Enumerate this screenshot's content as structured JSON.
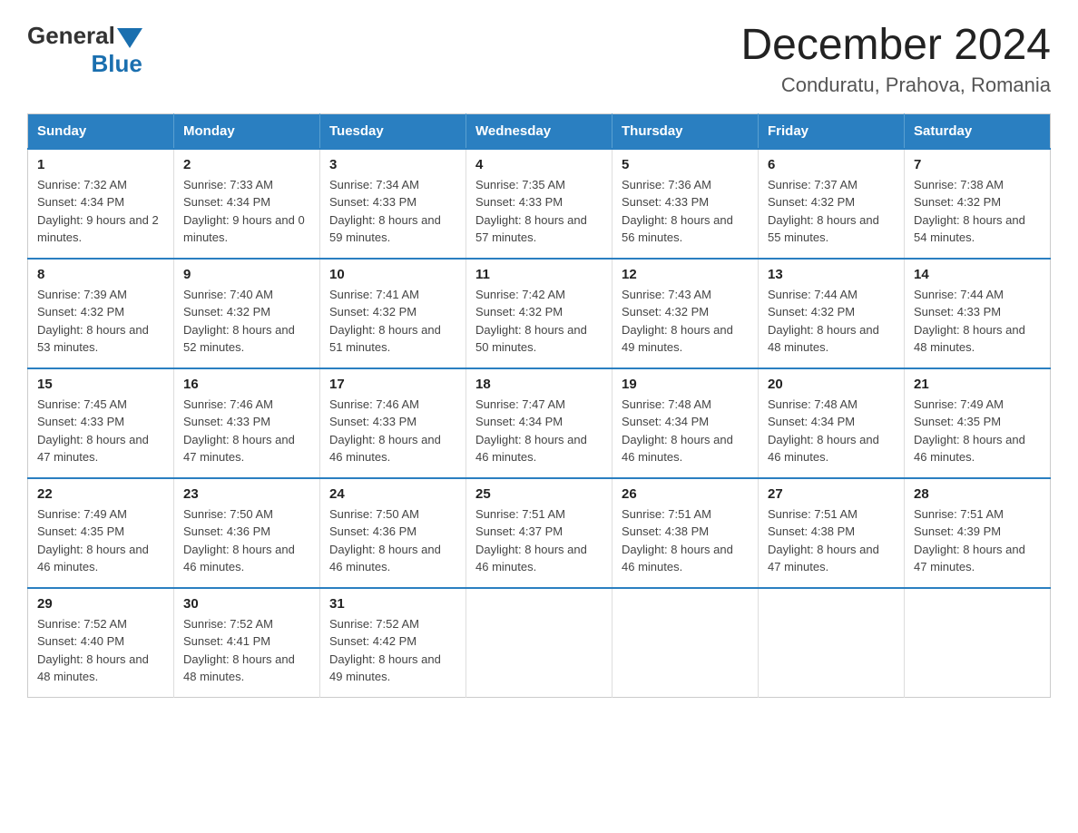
{
  "header": {
    "logo": {
      "general": "General",
      "blue": "Blue"
    },
    "title": "December 2024",
    "subtitle": "Conduratu, Prahova, Romania"
  },
  "calendar": {
    "weekdays": [
      "Sunday",
      "Monday",
      "Tuesday",
      "Wednesday",
      "Thursday",
      "Friday",
      "Saturday"
    ],
    "weeks": [
      [
        {
          "day": "1",
          "sunrise": "7:32 AM",
          "sunset": "4:34 PM",
          "daylight": "9 hours and 2 minutes."
        },
        {
          "day": "2",
          "sunrise": "7:33 AM",
          "sunset": "4:34 PM",
          "daylight": "9 hours and 0 minutes."
        },
        {
          "day": "3",
          "sunrise": "7:34 AM",
          "sunset": "4:33 PM",
          "daylight": "8 hours and 59 minutes."
        },
        {
          "day": "4",
          "sunrise": "7:35 AM",
          "sunset": "4:33 PM",
          "daylight": "8 hours and 57 minutes."
        },
        {
          "day": "5",
          "sunrise": "7:36 AM",
          "sunset": "4:33 PM",
          "daylight": "8 hours and 56 minutes."
        },
        {
          "day": "6",
          "sunrise": "7:37 AM",
          "sunset": "4:32 PM",
          "daylight": "8 hours and 55 minutes."
        },
        {
          "day": "7",
          "sunrise": "7:38 AM",
          "sunset": "4:32 PM",
          "daylight": "8 hours and 54 minutes."
        }
      ],
      [
        {
          "day": "8",
          "sunrise": "7:39 AM",
          "sunset": "4:32 PM",
          "daylight": "8 hours and 53 minutes."
        },
        {
          "day": "9",
          "sunrise": "7:40 AM",
          "sunset": "4:32 PM",
          "daylight": "8 hours and 52 minutes."
        },
        {
          "day": "10",
          "sunrise": "7:41 AM",
          "sunset": "4:32 PM",
          "daylight": "8 hours and 51 minutes."
        },
        {
          "day": "11",
          "sunrise": "7:42 AM",
          "sunset": "4:32 PM",
          "daylight": "8 hours and 50 minutes."
        },
        {
          "day": "12",
          "sunrise": "7:43 AM",
          "sunset": "4:32 PM",
          "daylight": "8 hours and 49 minutes."
        },
        {
          "day": "13",
          "sunrise": "7:44 AM",
          "sunset": "4:32 PM",
          "daylight": "8 hours and 48 minutes."
        },
        {
          "day": "14",
          "sunrise": "7:44 AM",
          "sunset": "4:33 PM",
          "daylight": "8 hours and 48 minutes."
        }
      ],
      [
        {
          "day": "15",
          "sunrise": "7:45 AM",
          "sunset": "4:33 PM",
          "daylight": "8 hours and 47 minutes."
        },
        {
          "day": "16",
          "sunrise": "7:46 AM",
          "sunset": "4:33 PM",
          "daylight": "8 hours and 47 minutes."
        },
        {
          "day": "17",
          "sunrise": "7:46 AM",
          "sunset": "4:33 PM",
          "daylight": "8 hours and 46 minutes."
        },
        {
          "day": "18",
          "sunrise": "7:47 AM",
          "sunset": "4:34 PM",
          "daylight": "8 hours and 46 minutes."
        },
        {
          "day": "19",
          "sunrise": "7:48 AM",
          "sunset": "4:34 PM",
          "daylight": "8 hours and 46 minutes."
        },
        {
          "day": "20",
          "sunrise": "7:48 AM",
          "sunset": "4:34 PM",
          "daylight": "8 hours and 46 minutes."
        },
        {
          "day": "21",
          "sunrise": "7:49 AM",
          "sunset": "4:35 PM",
          "daylight": "8 hours and 46 minutes."
        }
      ],
      [
        {
          "day": "22",
          "sunrise": "7:49 AM",
          "sunset": "4:35 PM",
          "daylight": "8 hours and 46 minutes."
        },
        {
          "day": "23",
          "sunrise": "7:50 AM",
          "sunset": "4:36 PM",
          "daylight": "8 hours and 46 minutes."
        },
        {
          "day": "24",
          "sunrise": "7:50 AM",
          "sunset": "4:36 PM",
          "daylight": "8 hours and 46 minutes."
        },
        {
          "day": "25",
          "sunrise": "7:51 AM",
          "sunset": "4:37 PM",
          "daylight": "8 hours and 46 minutes."
        },
        {
          "day": "26",
          "sunrise": "7:51 AM",
          "sunset": "4:38 PM",
          "daylight": "8 hours and 46 minutes."
        },
        {
          "day": "27",
          "sunrise": "7:51 AM",
          "sunset": "4:38 PM",
          "daylight": "8 hours and 47 minutes."
        },
        {
          "day": "28",
          "sunrise": "7:51 AM",
          "sunset": "4:39 PM",
          "daylight": "8 hours and 47 minutes."
        }
      ],
      [
        {
          "day": "29",
          "sunrise": "7:52 AM",
          "sunset": "4:40 PM",
          "daylight": "8 hours and 48 minutes."
        },
        {
          "day": "30",
          "sunrise": "7:52 AM",
          "sunset": "4:41 PM",
          "daylight": "8 hours and 48 minutes."
        },
        {
          "day": "31",
          "sunrise": "7:52 AM",
          "sunset": "4:42 PM",
          "daylight": "8 hours and 49 minutes."
        },
        null,
        null,
        null,
        null
      ]
    ],
    "labels": {
      "sunrise": "Sunrise:",
      "sunset": "Sunset:",
      "daylight": "Daylight:"
    }
  }
}
